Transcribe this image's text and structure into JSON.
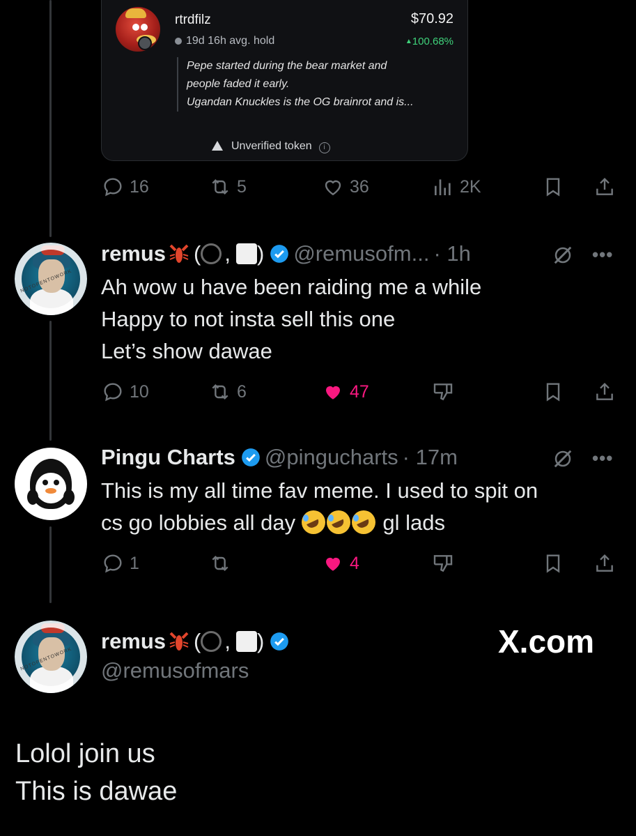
{
  "card": {
    "username": "rtrdfilz",
    "price": "$70.92",
    "hold": "19d 16h avg. hold",
    "change": "100.68%",
    "quote_lines": [
      "Pepe started during the bear market and",
      "people faded it early.",
      "Ugandan Knuckles is the OG brainrot and is..."
    ],
    "warning": "Unverified token"
  },
  "top_actions": {
    "replies": "16",
    "reposts": "5",
    "likes": "36",
    "views": "2K"
  },
  "tweets": [
    {
      "name": "remus",
      "punct_open": "(",
      "punct_comma": ",",
      "punct_close": ")",
      "handle": "@remusofm...",
      "time": "· 1h",
      "lines": [
        "Ah wow u have been raiding me a while",
        "Happy to not insta sell this one",
        "Let’s show dawae"
      ],
      "replies": "10",
      "reposts": "6",
      "likes": "47"
    },
    {
      "name": "Pingu Charts",
      "handle": "@pingucharts",
      "time": "· 17m",
      "lines": [
        "This is my all time fav meme. I used to spit on",
        "cs go lobbies all day",
        "gl lads"
      ],
      "replies": "1",
      "likes": "4"
    }
  ],
  "main_tweet": {
    "name": "remus",
    "punct_open": "(",
    "punct_comma": ",",
    "punct_close": ")",
    "handle": "@remusofmars",
    "watermark": "X.com",
    "lines": [
      "Lolol join us",
      "This is dawae"
    ]
  },
  "avatar_ring_text": "NOTOPENTOWORK",
  "colors": {
    "background": "#000000",
    "like_active": "#f91880",
    "verified": "#1d9bf0",
    "muted": "#71767b",
    "up": "#3fd17a"
  }
}
